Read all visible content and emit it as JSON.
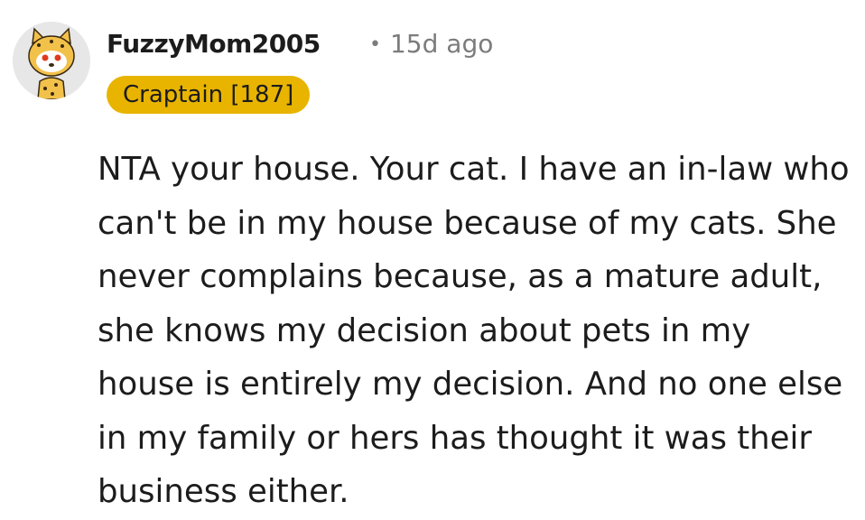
{
  "comment": {
    "avatar_icon": "snoo-cheetah-avatar-icon",
    "username": "FuzzyMom2005",
    "separator": "•",
    "timestamp": "15d ago",
    "flair": "Craptain [187]",
    "flair_color": "#e8b400",
    "body": "NTA your house. Your cat. I have an in-law who can't be in my house because of my cats. She never complains because, as a mature adult, she knows my decision about pets in my house is entirely my decision. And no one else in my family or hers has thought it was their business either."
  }
}
